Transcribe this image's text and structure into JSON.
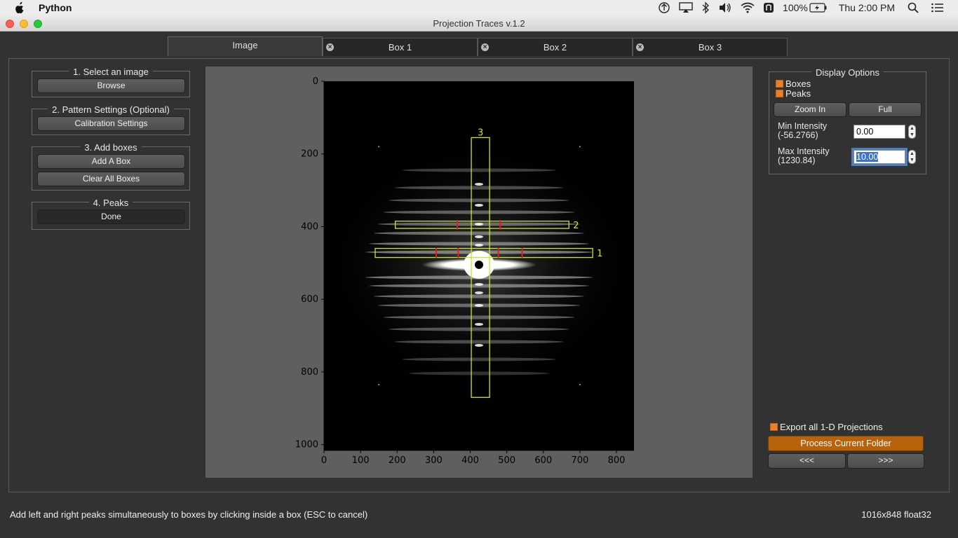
{
  "menubar": {
    "app_name": "Python",
    "battery": "100%",
    "clock": "Thu 2:00 PM"
  },
  "window": {
    "title": "Projection Traces v.1.2"
  },
  "tabs": [
    {
      "label": "Image",
      "closable": false,
      "active": true
    },
    {
      "label": "Box 1",
      "closable": true,
      "active": false
    },
    {
      "label": "Box 2",
      "closable": true,
      "active": false
    },
    {
      "label": "Box 3",
      "closable": true,
      "active": false
    }
  ],
  "left_panel": {
    "select_image": {
      "title": "1. Select an image",
      "browse": "Browse"
    },
    "pattern_settings": {
      "title": "2. Pattern Settings (Optional)",
      "calibration": "Calibration Settings"
    },
    "add_boxes": {
      "title": "3. Add boxes",
      "add": "Add A Box",
      "clear": "Clear All Boxes"
    },
    "peaks": {
      "title": "4. Peaks",
      "done": "Done"
    }
  },
  "plot": {
    "x_ticks": [
      "0",
      "100",
      "200",
      "300",
      "400",
      "500",
      "600",
      "700",
      "800"
    ],
    "y_ticks": [
      "0",
      "200",
      "400",
      "600",
      "800",
      "1000"
    ],
    "image_width": 848,
    "image_height": 1016,
    "boxes": [
      {
        "label": "1",
        "x_range": [
          140,
          735
        ],
        "y_range": [
          460,
          485
        ]
      },
      {
        "label": "2",
        "x_range": [
          195,
          670
        ],
        "y_range": [
          385,
          405
        ]
      },
      {
        "label": "3",
        "x_range": [
          403,
          453
        ],
        "y_range": [
          155,
          870
        ]
      }
    ],
    "peaks": [
      {
        "box": "1",
        "x": 307,
        "y": 472
      },
      {
        "box": "1",
        "x": 367,
        "y": 472
      },
      {
        "box": "1",
        "x": 477,
        "y": 472
      },
      {
        "box": "1",
        "x": 542,
        "y": 472
      },
      {
        "box": "2",
        "x": 365,
        "y": 395
      },
      {
        "box": "2",
        "x": 482,
        "y": 395
      }
    ],
    "colors": {
      "box": "#c8e62a",
      "peak": "#e41a1c",
      "label": "#c8e62a"
    }
  },
  "display_options": {
    "title": "Display Options",
    "boxes_label": "Boxes",
    "peaks_label": "Peaks",
    "zoom_in": "Zoom In",
    "full": "Full",
    "min_intensity_label": "Min Intensity",
    "min_intensity_range": "(-56.2766)",
    "min_intensity_value": "0.00",
    "max_intensity_label": "Max Intensity",
    "max_intensity_range": "(1230.84)",
    "max_intensity_value": "10.00"
  },
  "bottom_right": {
    "export_label": "Export all 1-D Projections",
    "process": "Process Current Folder",
    "prev": "<<<",
    "next": ">>>"
  },
  "status": {
    "message": "Add left and right peaks simultaneously to boxes by clicking inside a box (ESC to cancel)",
    "image_info": "1016x848 float32"
  }
}
